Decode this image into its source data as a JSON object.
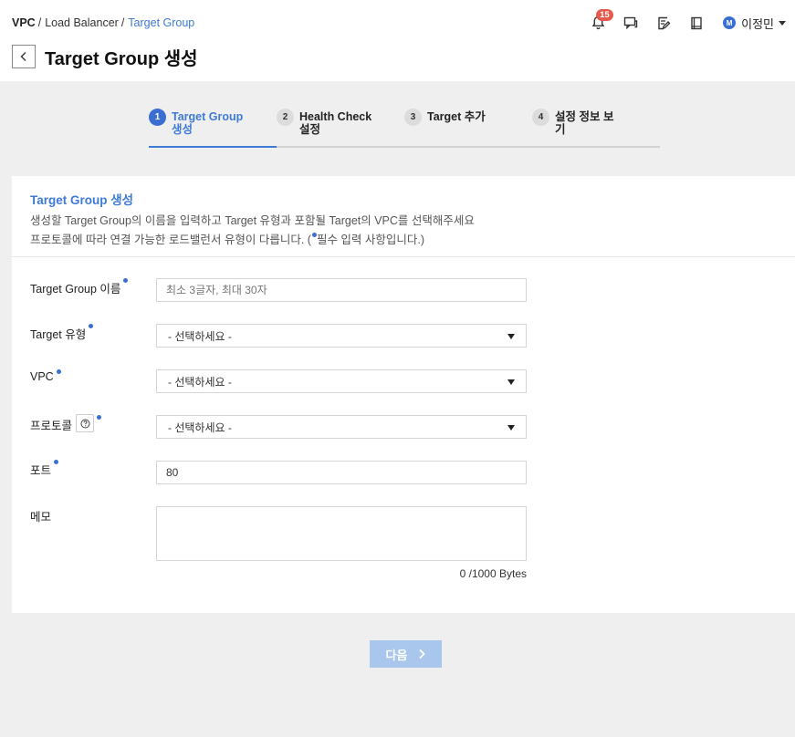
{
  "breadcrumb": {
    "items": [
      "VPC",
      "Load Balancer",
      "Target Group"
    ]
  },
  "header": {
    "title": "Target Group 생성",
    "notifications_count": "15",
    "user_initial": "M",
    "user_name": "이정민"
  },
  "stepper": {
    "steps": [
      {
        "num": "1",
        "label": "Target Group 생성",
        "active": true
      },
      {
        "num": "2",
        "label": "Health Check 설정",
        "active": false
      },
      {
        "num": "3",
        "label": "Target 추가",
        "active": false
      },
      {
        "num": "4",
        "label": "설정 정보 보기",
        "active": false
      }
    ]
  },
  "form": {
    "section_title": "Target Group 생성",
    "description_line1": "생성할 Target Group의 이름을 입력하고 Target 유형과 포함될 Target의 VPC를 선택해주세요",
    "description_line2_pre": "프로토콜에 따라 연결 가능한 로드밸런서 유형이 다릅니다. (",
    "description_line2_post": "필수 입력 사항입니다.)",
    "fields": {
      "name": {
        "label": "Target Group 이름",
        "placeholder": "최소 3글자, 최대 30자",
        "value": ""
      },
      "target_type": {
        "label": "Target 유형",
        "value": "- 선택하세요 -"
      },
      "vpc": {
        "label": "VPC",
        "value": "- 선택하세요 -"
      },
      "protocol": {
        "label": "프로토콜",
        "value": "- 선택하세요 -"
      },
      "port": {
        "label": "포트",
        "value": "80"
      },
      "memo": {
        "label": "메모",
        "value": "",
        "counter": "0 /1000 Bytes"
      }
    }
  },
  "actions": {
    "next_label": "다음"
  },
  "colors": {
    "accent": "#3f7bd5",
    "badge": "#e65a4e",
    "disabled_button": "#a9c6ec",
    "page_background": "#efefef"
  },
  "icons": [
    "bell-icon",
    "chat-icon",
    "edit-note-icon",
    "book-icon",
    "chevron-left-icon",
    "question-icon",
    "chevron-right-icon",
    "caret-down-icon"
  ]
}
